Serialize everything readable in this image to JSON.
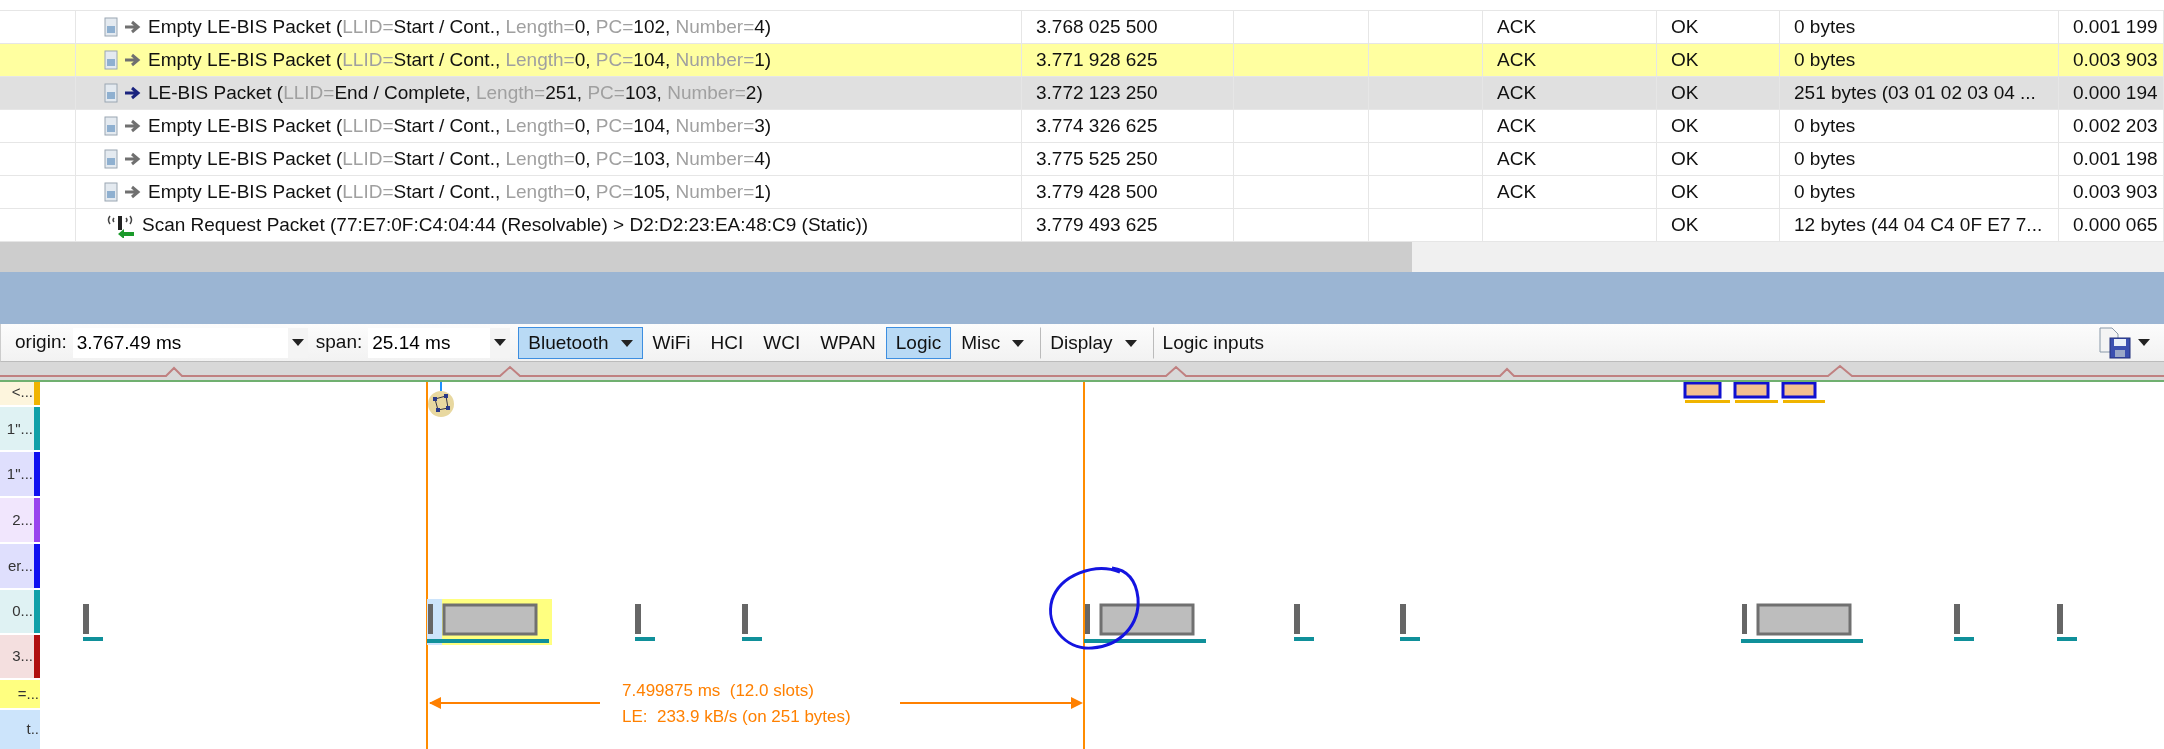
{
  "packet_list": {
    "rows": [
      {
        "kind": "empty",
        "summary": [
          "Empty LE-BIS Packet (",
          "LLID=",
          "Start / Cont., ",
          "Length=",
          "0, ",
          "PC=",
          "102, ",
          "Number=",
          "4)"
        ],
        "time": "3.768 025 500",
        "response": "ACK",
        "status": "OK",
        "payload": "0 bytes",
        "delta": "0.001 199",
        "marked": false,
        "selected": false
      },
      {
        "kind": "empty",
        "summary": [
          "Empty LE-BIS Packet (",
          "LLID=",
          "Start / Cont., ",
          "Length=",
          "0, ",
          "PC=",
          "104, ",
          "Number=",
          "1)"
        ],
        "time": "3.771 928 625",
        "response": "ACK",
        "status": "OK",
        "payload": "0 bytes",
        "delta": "0.003 903",
        "marked": true,
        "selected": false
      },
      {
        "kind": "data",
        "summary": [
          "LE-BIS Packet (",
          "LLID=",
          "End / Complete, ",
          "Length=",
          "251, ",
          "PC=",
          "103, ",
          "Number=",
          "2)"
        ],
        "time": "3.772 123 250",
        "response": "ACK",
        "status": "OK",
        "payload": "251 bytes (03 01 02 03 04 ...",
        "delta": "0.000 194",
        "marked": false,
        "selected": true
      },
      {
        "kind": "empty",
        "summary": [
          "Empty LE-BIS Packet (",
          "LLID=",
          "Start / Cont., ",
          "Length=",
          "0, ",
          "PC=",
          "104, ",
          "Number=",
          "3)"
        ],
        "time": "3.774 326 625",
        "response": "ACK",
        "status": "OK",
        "payload": "0 bytes",
        "delta": "0.002 203",
        "marked": false,
        "selected": false
      },
      {
        "kind": "empty",
        "summary": [
          "Empty LE-BIS Packet (",
          "LLID=",
          "Start / Cont., ",
          "Length=",
          "0, ",
          "PC=",
          "103, ",
          "Number=",
          "4)"
        ],
        "time": "3.775 525 250",
        "response": "ACK",
        "status": "OK",
        "payload": "0 bytes",
        "delta": "0.001 198",
        "marked": false,
        "selected": false
      },
      {
        "kind": "empty",
        "summary": [
          "Empty LE-BIS Packet (",
          "LLID=",
          "Start / Cont., ",
          "Length=",
          "0, ",
          "PC=",
          "105, ",
          "Number=",
          "1)"
        ],
        "time": "3.779 428 500",
        "response": "ACK",
        "status": "OK",
        "payload": "0 bytes",
        "delta": "0.003 903",
        "marked": false,
        "selected": false
      },
      {
        "kind": "scan",
        "summary": [
          "Scan Request Packet (77:E7:0F:C4:04:44 (Resolvable) > D2:D2:23:EA:48:C9 (Static))"
        ],
        "time": "3.779 493 625",
        "status": "OK",
        "payload": "12 bytes (44 04 C4 0F E7 7...",
        "delta": "0.000 065",
        "marked": false,
        "selected": false
      }
    ]
  },
  "toolbar": {
    "origin": {
      "label": "origin:",
      "value": "3.767.49 ms"
    },
    "span": {
      "label": "span:",
      "value": "25.14 ms"
    },
    "buttons": [
      {
        "label": "Bluetooth",
        "selected": true,
        "dropdown": true,
        "separator_before": false
      },
      {
        "label": "WiFi",
        "selected": false,
        "dropdown": false,
        "separator_before": false
      },
      {
        "label": "HCI",
        "selected": false,
        "dropdown": false,
        "separator_before": false
      },
      {
        "label": "WCI",
        "selected": false,
        "dropdown": false,
        "separator_before": false
      },
      {
        "label": "WPAN",
        "selected": false,
        "dropdown": false,
        "separator_before": false
      },
      {
        "label": "Logic",
        "selected": true,
        "dropdown": false,
        "separator_before": false
      },
      {
        "label": "Misc",
        "selected": false,
        "dropdown": true,
        "separator_before": false
      },
      {
        "label": "Display",
        "selected": false,
        "dropdown": true,
        "separator_before": true
      },
      {
        "label": "Logic inputs",
        "selected": false,
        "dropdown": false,
        "separator_before": true
      }
    ]
  },
  "timeline": {
    "lanes": [
      {
        "label": "<...",
        "kind": "edge",
        "color": "#f0b400"
      },
      {
        "label": "1\"...",
        "kind": "edge",
        "color": "#10a0a8"
      },
      {
        "label": "1\"...",
        "kind": "edge",
        "color": "#1010f0"
      },
      {
        "label": "2...",
        "kind": "edge",
        "color": "#9944ee"
      },
      {
        "label": "er...",
        "kind": "edge",
        "color": "#1010f0"
      },
      {
        "label": "0...",
        "kind": "edge",
        "color": "#10a0a8"
      },
      {
        "label": "3...",
        "kind": "edge",
        "color": "#b01010"
      },
      {
        "label": "=...",
        "kind": "fill",
        "color": "#ffff80"
      },
      {
        "label": "t..",
        "kind": "fill",
        "color": "#cce4fb"
      }
    ],
    "measurement": {
      "duration": "7.499875 ms  (12.0 slots)",
      "rate": "LE:  233.9 kB/s (on 251 bytes)"
    }
  }
}
